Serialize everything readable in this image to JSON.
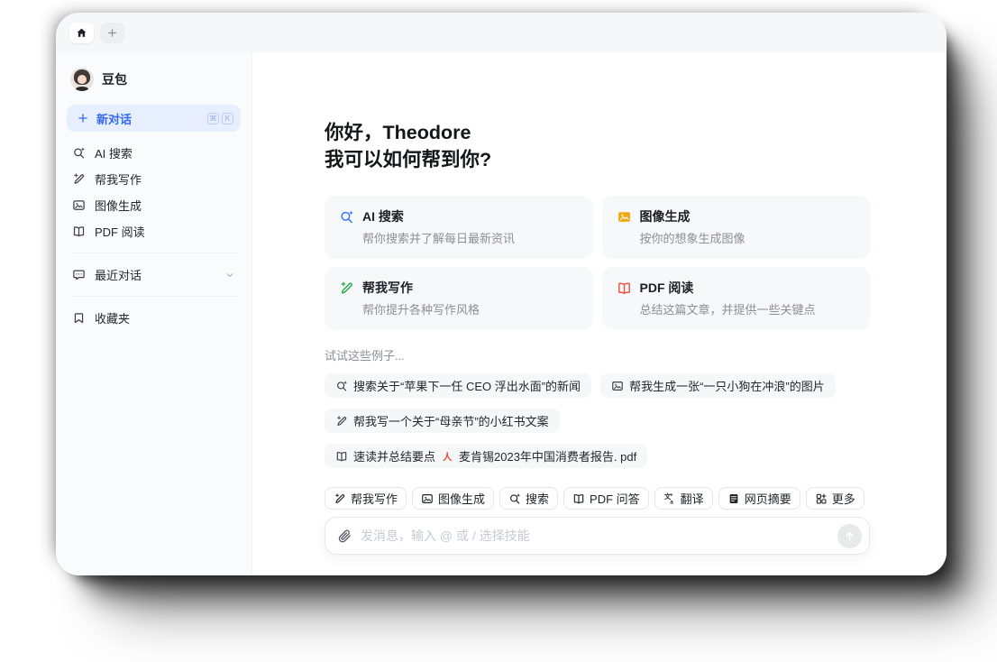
{
  "tabbar": {
    "new_tab_plus": "+"
  },
  "sidebar": {
    "profile_name": "豆包",
    "new_chat": {
      "label": "新对话",
      "shortcut": [
        "⌘",
        "K"
      ]
    },
    "items": [
      {
        "label": "AI 搜索"
      },
      {
        "label": "帮我写作"
      },
      {
        "label": "图像生成"
      },
      {
        "label": "PDF 阅读"
      }
    ],
    "recent_label": "最近对话",
    "favorites_label": "收藏夹"
  },
  "main": {
    "greeting_line1": "你好，Theodore",
    "greeting_line2": "我可以如何帮到你?",
    "cards": [
      {
        "title": "AI 搜索",
        "desc": "帮你搜索并了解每日最新资讯",
        "color": "#3370ff"
      },
      {
        "title": "图像生成",
        "desc": "按你的想象生成图像",
        "color": "#f0a80a"
      },
      {
        "title": "帮我写作",
        "desc": "帮你提升各种写作风格",
        "color": "#23a84a"
      },
      {
        "title": "PDF 阅读",
        "desc": "总结这篇文章，并提供一些关键点",
        "color": "#ef5144"
      }
    ],
    "examples_heading": "试试这些例子...",
    "example_chips": [
      {
        "text": "搜索关于“苹果下一任 CEO 浮出水面”的新闻"
      },
      {
        "text": "帮我生成一张“一只小狗在冲浪”的图片"
      },
      {
        "text": "帮我写一个关于“母亲节”的小红书文案"
      },
      {
        "text": "速读并总结要点",
        "attachment": "麦肯锡2023年中国消费者报告. pdf"
      }
    ],
    "skills": [
      {
        "label": "帮我写作"
      },
      {
        "label": "图像生成"
      },
      {
        "label": "搜索"
      },
      {
        "label": "PDF 问答"
      },
      {
        "label": "翻译"
      },
      {
        "label": "网页摘要"
      },
      {
        "label": "更多"
      }
    ],
    "composer": {
      "placeholder": "发消息，输入 @ 或 / 选择技能"
    }
  },
  "colors": {
    "brand_blue": "#3369f4",
    "new_chat_bg": "#e7eefe",
    "card_bg": "#f7f8fa",
    "pdf_red": "#eb4b3d"
  }
}
